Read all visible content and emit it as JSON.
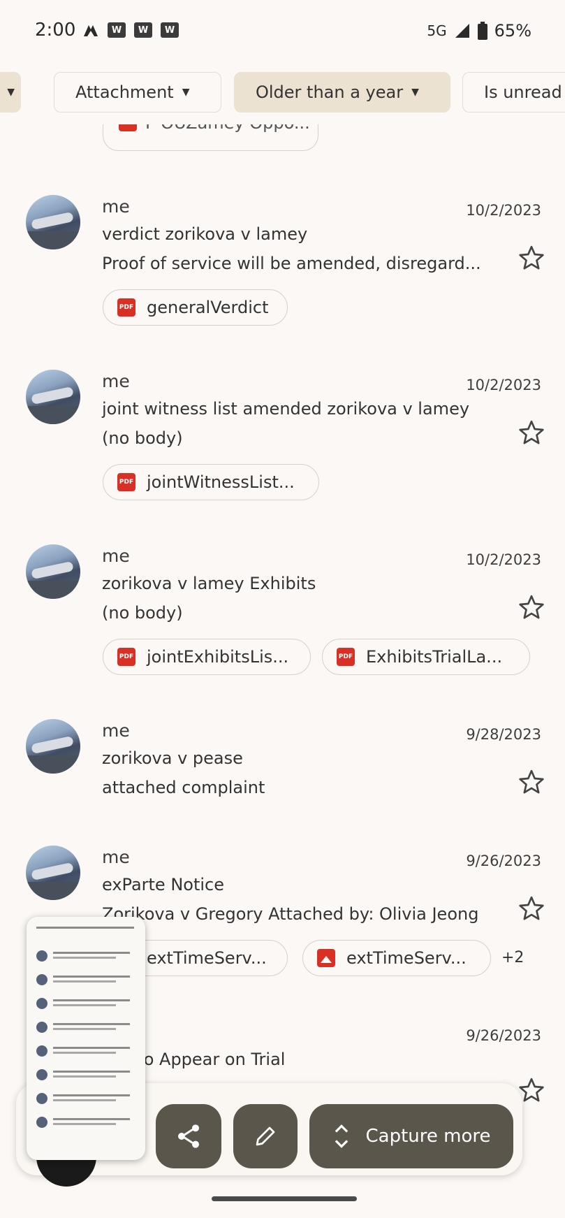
{
  "status": {
    "time": "2:00",
    "network": "5G",
    "battery": "65%"
  },
  "filters": [
    {
      "label": "",
      "selected": true
    },
    {
      "label": "Attachment",
      "selected": false
    },
    {
      "label": "Older than a year",
      "selected": true
    },
    {
      "label": "Is unread",
      "selected": false
    }
  ],
  "partial_attachment": "P OUZamey Oppo...",
  "emails": [
    {
      "sender": "me",
      "date": "10/2/2023",
      "subject": "verdict zorikova v lamey",
      "snippet": "Proof of service will be amended, disregard...",
      "attachments": [
        {
          "name": "generalVerdict",
          "type": "pdf"
        }
      ],
      "more": ""
    },
    {
      "sender": "me",
      "date": "10/2/2023",
      "subject": "joint witness list amended zorikova v lamey",
      "snippet": "(no body)",
      "attachments": [
        {
          "name": "jointWitnessList...",
          "type": "pdf"
        }
      ],
      "more": ""
    },
    {
      "sender": "me",
      "date": "10/2/2023",
      "subject": "zorikova v lamey Exhibits",
      "snippet": "(no body)",
      "attachments": [
        {
          "name": "jointExhibitsLis...",
          "type": "pdf"
        },
        {
          "name": "ExhibitsTrialLa...",
          "type": "pdf"
        }
      ],
      "more": ""
    },
    {
      "sender": "me",
      "date": "9/28/2023",
      "subject": "zorikova v pease",
      "snippet": "attached complaint",
      "attachments": [],
      "more": ""
    },
    {
      "sender": "me",
      "date": "9/26/2023",
      "subject": "exParte Notice",
      "snippet": "Zorikova v Gregory Attached by: Olivia Jeong",
      "attachments": [
        {
          "name": "extTimeServ...",
          "type": "image"
        },
        {
          "name": "extTimeServ...",
          "type": "image"
        }
      ],
      "more": "+2"
    },
    {
      "sender": "me",
      "date": "9/26/2023",
      "subject": "Notice to Appear on Trial",
      "snippet": "",
      "attachments": [],
      "more": ""
    }
  ],
  "toolbar": {
    "capture_more": "Capture more"
  },
  "colors": {
    "background": "#fbf8f5",
    "selected_chip": "#ece2d2",
    "toolbar_button": "#5b564c",
    "pdf_red": "#d93025"
  }
}
